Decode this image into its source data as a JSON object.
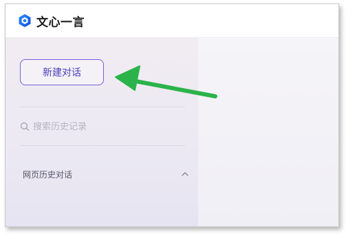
{
  "app": {
    "brand_name": "文心一言",
    "logo_icon": "ernie-logo-icon"
  },
  "sidebar": {
    "new_chat_label": "新建对话",
    "search": {
      "placeholder": "搜索历史记录",
      "value": ""
    },
    "section": {
      "title": "网页历史对话",
      "chevron_icon": "chevron-up-icon",
      "expanded": true
    }
  },
  "annotation": {
    "arrow_color": "#2bb34a",
    "arrow_target": "new-chat-button"
  },
  "colors": {
    "accent": "#6f5fe0",
    "sidebar_bg": "#ece9f3",
    "content_bg": "#f3f2f7"
  }
}
